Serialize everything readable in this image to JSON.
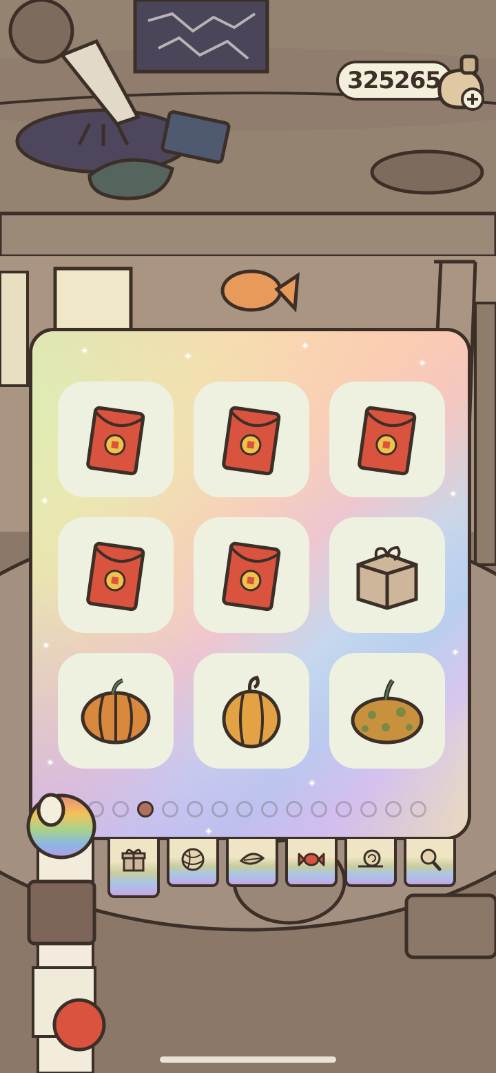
{
  "currency": {
    "amount": "325265",
    "add_icon": "plus-icon",
    "bag_icon": "coin-bag-icon"
  },
  "inventory": {
    "items": [
      {
        "name": "red envelope",
        "icon": "red-envelope-icon"
      },
      {
        "name": "red envelope",
        "icon": "red-envelope-icon"
      },
      {
        "name": "red envelope",
        "icon": "red-envelope-icon"
      },
      {
        "name": "red envelope",
        "icon": "red-envelope-icon"
      },
      {
        "name": "red envelope",
        "icon": "red-envelope-icon"
      },
      {
        "name": "cardboard package",
        "icon": "package-icon"
      },
      {
        "name": "orange pumpkin",
        "icon": "pumpkin-icon"
      },
      {
        "name": "golden pumpkin",
        "icon": "pumpkin-round-icon"
      },
      {
        "name": "speckled pumpkin",
        "icon": "pumpkin-speckled-icon"
      }
    ],
    "page_count": 14,
    "current_page": 3,
    "next_icon": "next-page-arrow-icon"
  },
  "tabs": [
    {
      "id": "gifts",
      "icon": "gift-icon",
      "active": true
    },
    {
      "id": "yarn",
      "icon": "yarn-ball-icon",
      "active": false
    },
    {
      "id": "leaves",
      "icon": "leaf-icon",
      "active": false
    },
    {
      "id": "candy",
      "icon": "candy-icon",
      "active": false
    },
    {
      "id": "snail",
      "icon": "snail-icon",
      "active": false
    },
    {
      "id": "search",
      "icon": "magnifier-icon",
      "active": false
    }
  ],
  "colors": {
    "outline": "#3b2f28",
    "envelope": "#d9533f",
    "slot": "#eef0e0",
    "pumpkin": "#d8893e"
  }
}
